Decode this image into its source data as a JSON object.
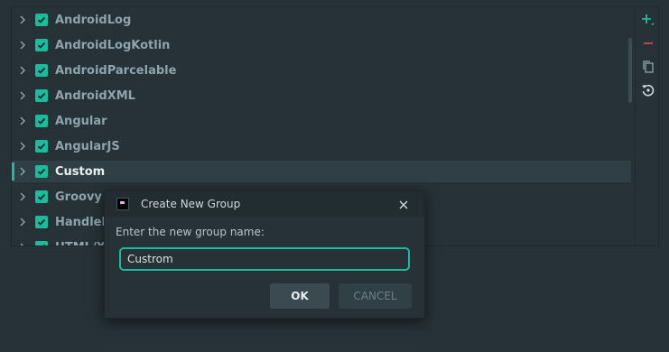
{
  "list": {
    "items": [
      {
        "label": "AndroidLog",
        "checked": true,
        "selected": false
      },
      {
        "label": "AndroidLogKotlin",
        "checked": true,
        "selected": false
      },
      {
        "label": "AndroidParcelable",
        "checked": true,
        "selected": false
      },
      {
        "label": "AndroidXML",
        "checked": true,
        "selected": false
      },
      {
        "label": "Angular",
        "checked": true,
        "selected": false
      },
      {
        "label": "AngularJS",
        "checked": true,
        "selected": false
      },
      {
        "label": "Custom",
        "checked": true,
        "selected": true
      },
      {
        "label": "Groovy",
        "checked": true,
        "selected": false
      },
      {
        "label": "Handlebars",
        "checked": true,
        "selected": false
      },
      {
        "label": "HTML/XML",
        "checked": true,
        "selected": false
      }
    ]
  },
  "toolbar": {
    "buttons": [
      {
        "icon": "plus-dropdown-icon",
        "color": "#1abc9c"
      },
      {
        "icon": "minus-icon",
        "color": "#d0454b"
      },
      {
        "icon": "copy-icon",
        "color": "#8fa3ad"
      },
      {
        "icon": "restore-icon",
        "color": "#cfd8dc"
      }
    ]
  },
  "dialog": {
    "title": "Create New Group",
    "prompt": "Enter the new group name:",
    "input_value": "Custrom",
    "ok_label": "OK",
    "cancel_label": "CANCEL"
  },
  "colors": {
    "background": "#263238",
    "accent": "#1abc9c",
    "danger": "#d0454b",
    "text": "#8fa3ad"
  }
}
